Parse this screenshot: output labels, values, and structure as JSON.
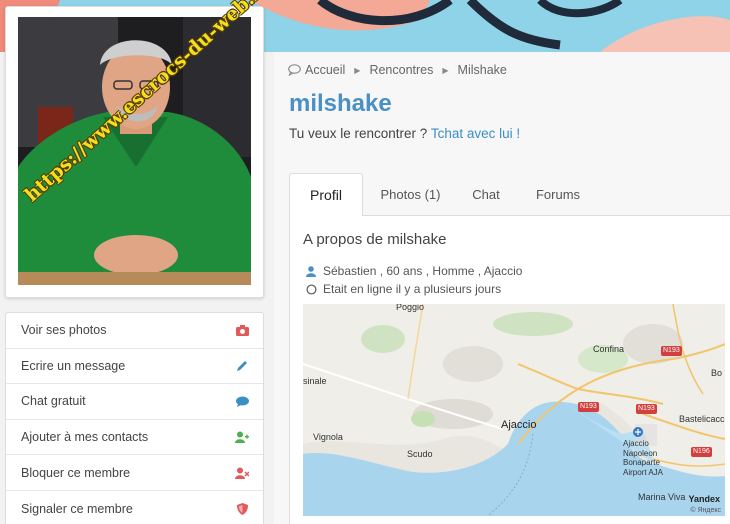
{
  "watermark": "https://www.escrocs-du-web.fr",
  "breadcrumb": {
    "items": [
      "Accueil",
      "Rencontres",
      "Milshake"
    ]
  },
  "profile": {
    "username": "milshake",
    "tagline_prefix": "Tu veux le rencontrer ?",
    "tagline_link": "Tchat avec lui !"
  },
  "tabs": [
    "Profil",
    "Photos (1)",
    "Chat",
    "Forums"
  ],
  "about": {
    "title": "A propos de milshake",
    "details": "Sébastien , 60 ans , Homme , Ajaccio",
    "status": "Etait en ligne il y a plusieurs jours"
  },
  "menu": [
    {
      "label": "Voir ses photos",
      "icon": "camera-icon",
      "color": "#e05a5a"
    },
    {
      "label": "Ecrire un message",
      "icon": "pencil-icon",
      "color": "#3a8fc7"
    },
    {
      "label": "Chat gratuit",
      "icon": "chat-icon",
      "color": "#3a8fc7"
    },
    {
      "label": "Ajouter à mes contacts",
      "icon": "add-user-icon",
      "color": "#4caf50"
    },
    {
      "label": "Bloquer ce membre",
      "icon": "block-user-icon",
      "color": "#e05a5a"
    },
    {
      "label": "Signaler ce membre",
      "icon": "shield-icon",
      "color": "#e05a5a"
    }
  ],
  "map": {
    "labels": [
      "Poggio",
      "Confina",
      "sinale",
      "Bo",
      "Bastelicacc",
      "Vignola",
      "Ajaccio",
      "Scudo",
      "Ajaccio Napoleon Bonaparte Airport AJA",
      "Marina Viva"
    ],
    "roads": [
      "N193",
      "N193",
      "N193",
      "N196"
    ],
    "provider": "Yandex",
    "copyright": "© Яндекс"
  },
  "colors": {
    "accent": "#3a8fc7",
    "username": "#4a90c4",
    "danger": "#e05a5a",
    "success": "#4caf50",
    "watermark": "#f0e020"
  }
}
